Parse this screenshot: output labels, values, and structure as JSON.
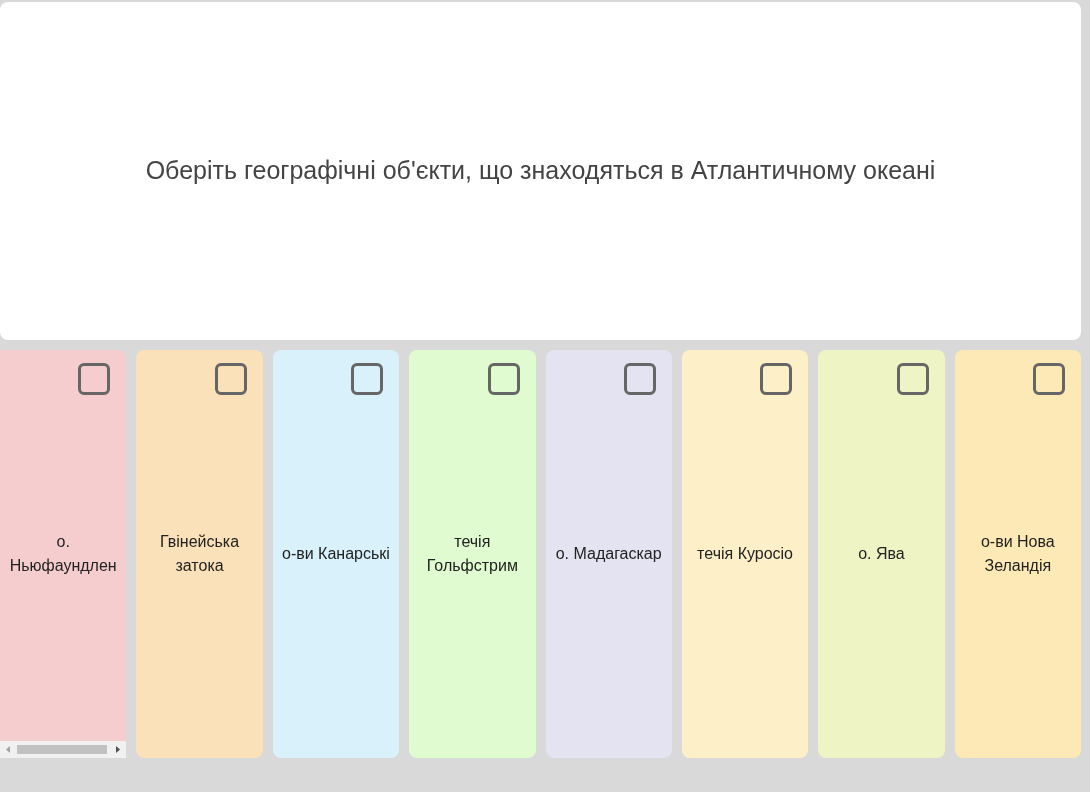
{
  "question": "Оберіть географічні об'єкти, що знаходяться в Атлантичному океані",
  "cards": [
    {
      "label": "о. Ньюфаундлен",
      "color": "#f5cdcf",
      "checked": false,
      "scrollbar": true
    },
    {
      "label": "Гвінейська затока",
      "color": "#fae1b9",
      "checked": false,
      "scrollbar": false
    },
    {
      "label": "о-ви Канарські",
      "color": "#d8f1fb",
      "checked": false,
      "scrollbar": false
    },
    {
      "label": "течія Гольфстрим",
      "color": "#e1fbd1",
      "checked": false,
      "scrollbar": false
    },
    {
      "label": "о. Мадагаскар",
      "color": "#e4e3f1",
      "checked": false,
      "scrollbar": false
    },
    {
      "label": "течія Куросіо",
      "color": "#fdf0c9",
      "checked": false,
      "scrollbar": false
    },
    {
      "label": "о. Ява",
      "color": "#eff4c5",
      "checked": false,
      "scrollbar": false
    },
    {
      "label": "о-ви Нова Зеландія",
      "color": "#fde9b5",
      "checked": false,
      "scrollbar": false
    }
  ]
}
